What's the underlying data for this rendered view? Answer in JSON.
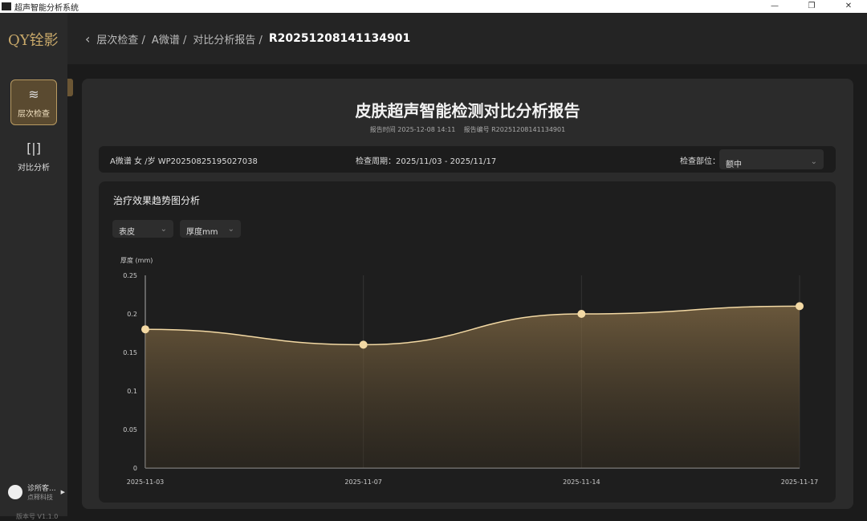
{
  "window": {
    "title": "超声智能分析系统"
  },
  "sidebar": {
    "logo": "QY铨影",
    "items": [
      {
        "label": "层次检查",
        "icon": "layers-icon"
      },
      {
        "label": "对比分析",
        "icon": "compare-icon"
      }
    ],
    "user": {
      "name": "诊所客...",
      "org": "点释科技"
    },
    "version": "版本号 V1.1.0"
  },
  "breadcrumb": [
    "层次检查 /",
    "A微谱 /",
    "对比分析报告 /"
  ],
  "breadcrumb_current": "R20251208141134901",
  "report": {
    "title": "皮肤超声智能检测对比分析报告",
    "time": "报告时间 2025-12-08 14:11",
    "number": "报告编号 R20251208141134901"
  },
  "info": {
    "patient": "A微谱 女 /岁 WP20250825195027038",
    "period": "检查周期：2025/11/03 - 2025/11/17",
    "site_label": "检查部位：",
    "site_value": "额中"
  },
  "panel": {
    "title": "治疗效果趋势图分析",
    "layer": "表皮",
    "metric": "厚度mm"
  },
  "chart_data": {
    "type": "area",
    "ylabel": "厚度 (mm)",
    "categories": [
      "2025-11-03",
      "2025-11-07",
      "2025-11-14",
      "2025-11-17"
    ],
    "values": [
      0.18,
      0.16,
      0.2,
      0.21
    ],
    "yticks": [
      0,
      0.05,
      0.1,
      0.15,
      0.2,
      0.25
    ],
    "ylim": [
      0,
      0.25
    ],
    "color": "#f3d9a4"
  }
}
